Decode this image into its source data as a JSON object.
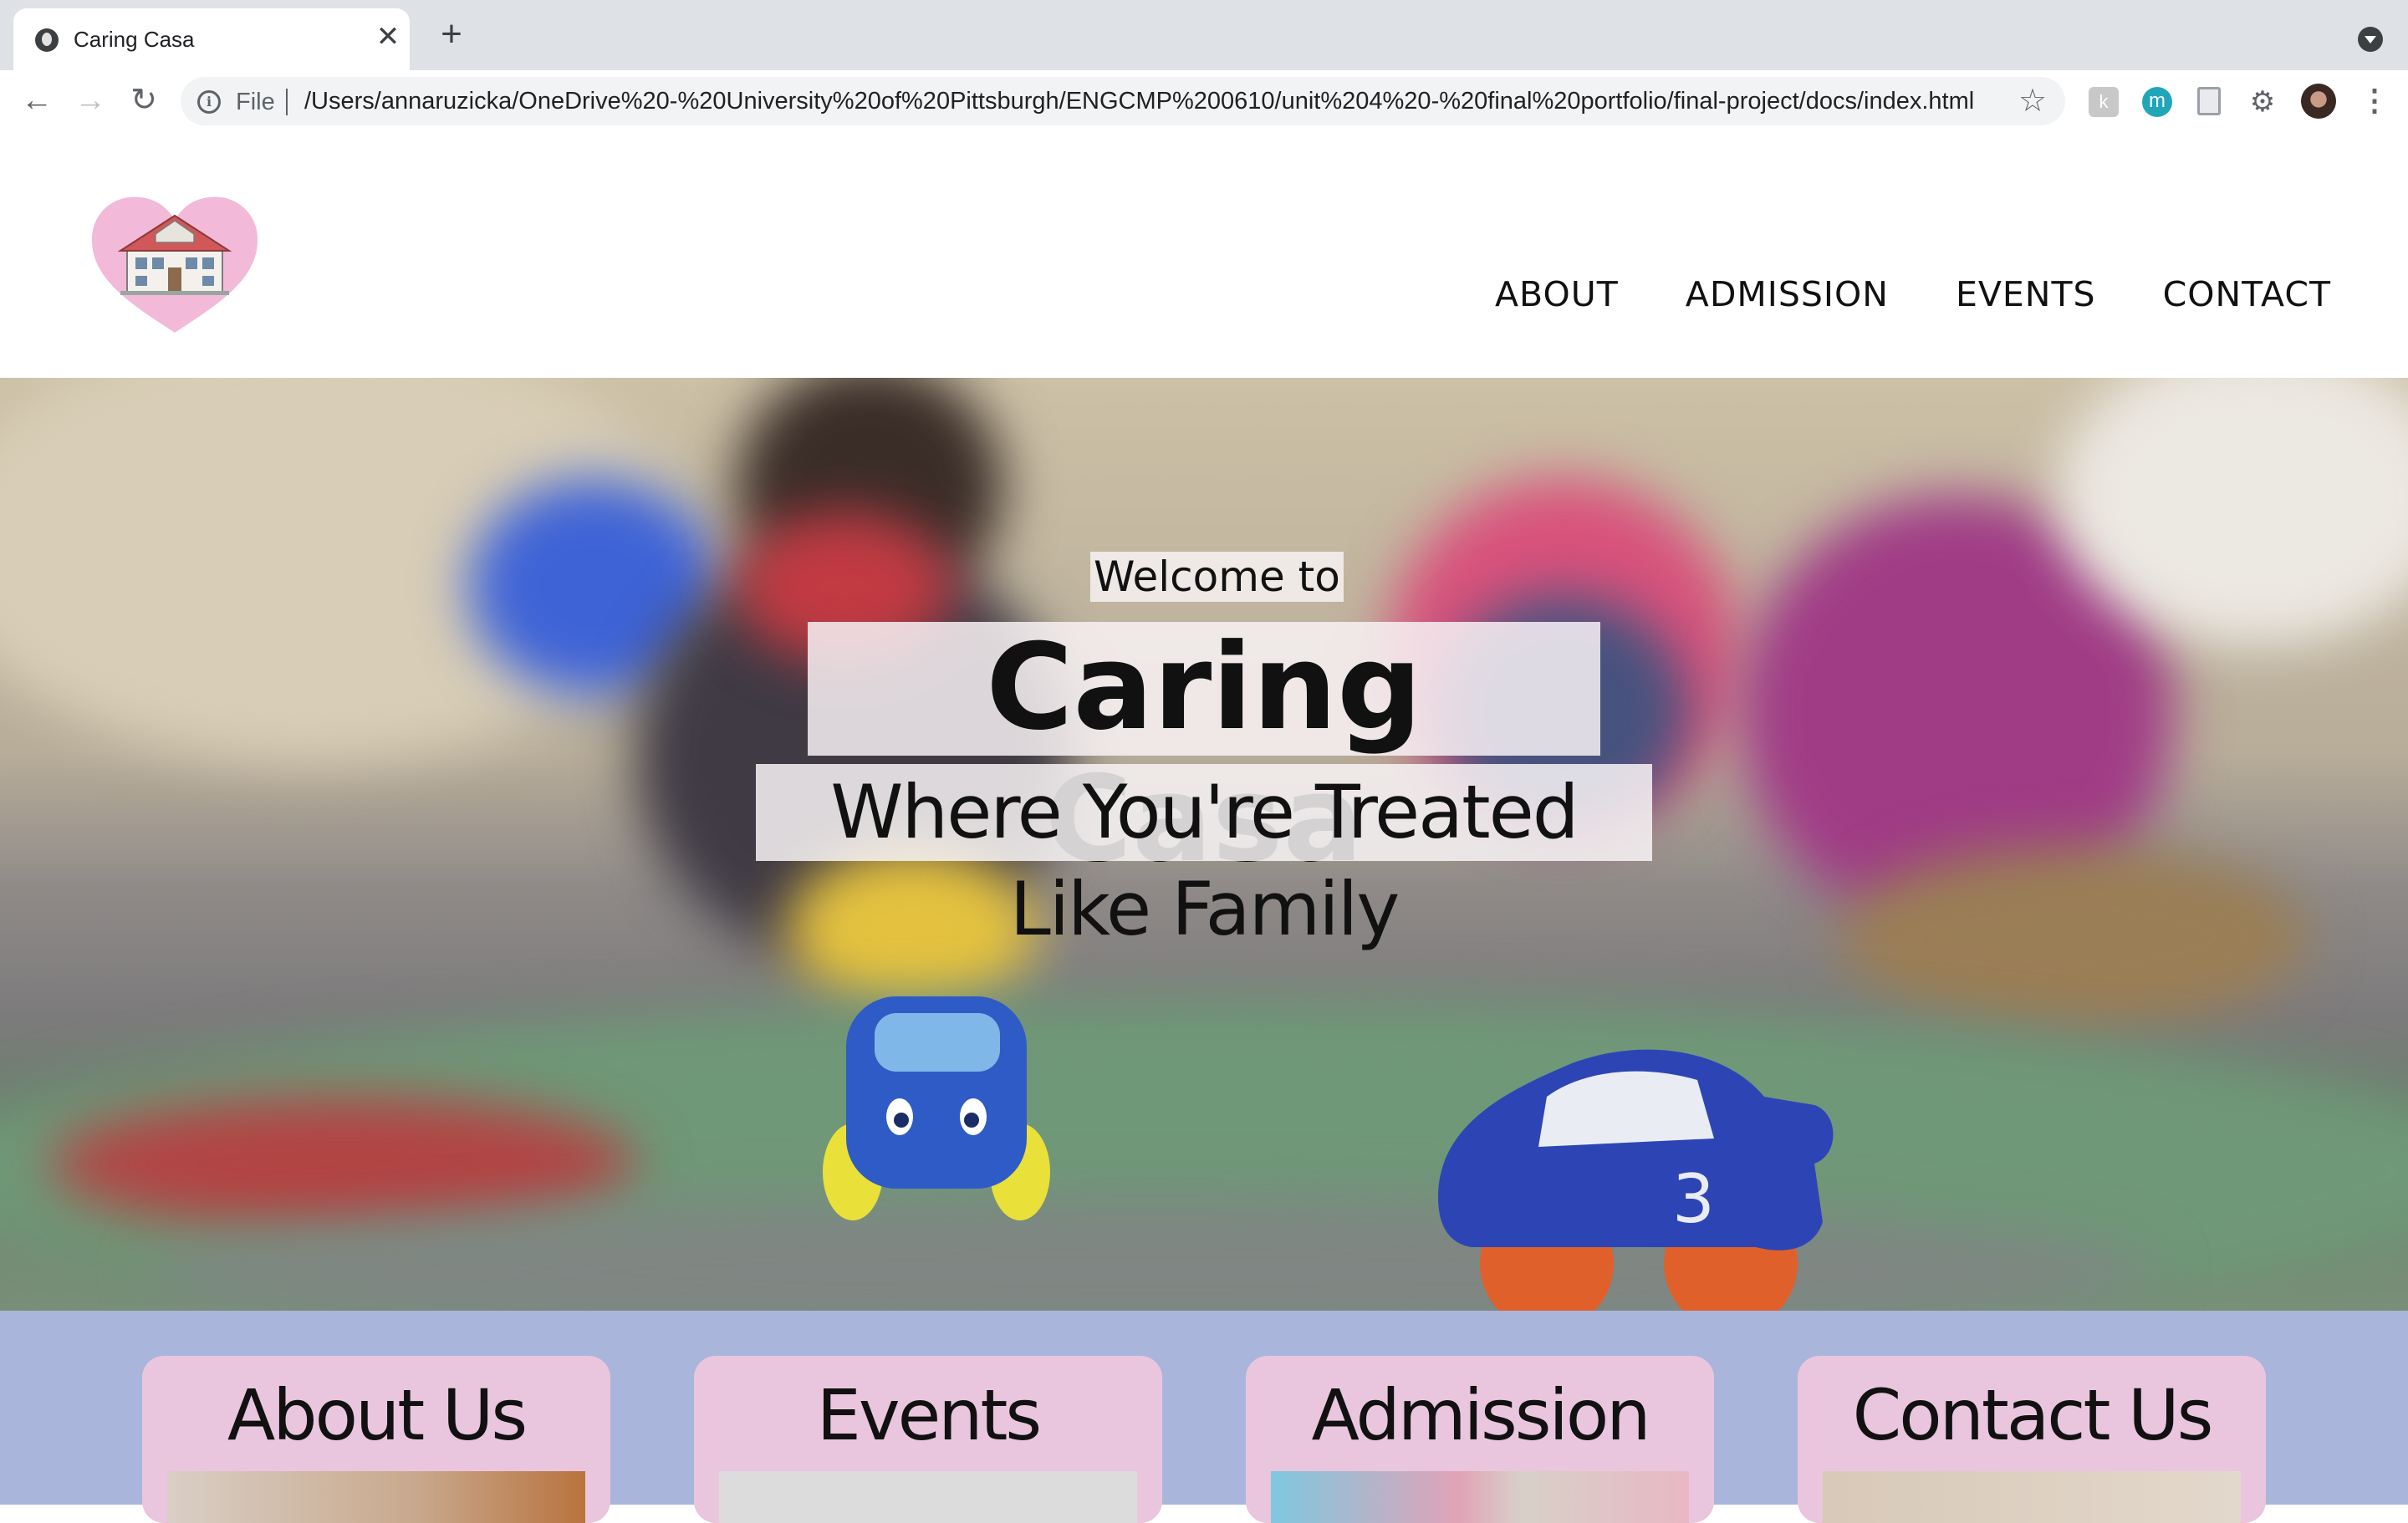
{
  "browser": {
    "tab_title": "Caring Casa",
    "tab_close": "✕",
    "new_tab": "+",
    "url_scheme": "File",
    "url": "/Users/annaruzicka/OneDrive%20-%20University%20of%20Pittsburgh/ENGCMP%200610/unit%204%20-%20final%20portfolio/final-project/docs/index.html",
    "extension_m": "m",
    "extension_k": "k"
  },
  "site": {
    "nav": [
      "ABOUT",
      "ADMISSION",
      "EVENTS",
      "CONTACT"
    ],
    "hero": {
      "welcome": "Welcome to",
      "title": "Caring Casa",
      "tagline": "Where You're Treated Like Family"
    },
    "cards": [
      "About Us",
      "Events",
      "Admission",
      "Contact Us"
    ]
  },
  "colors": {
    "card_bg": "#eac6de",
    "section_bg": "#a9b5da",
    "logo_heart": "#f3b9d8"
  }
}
